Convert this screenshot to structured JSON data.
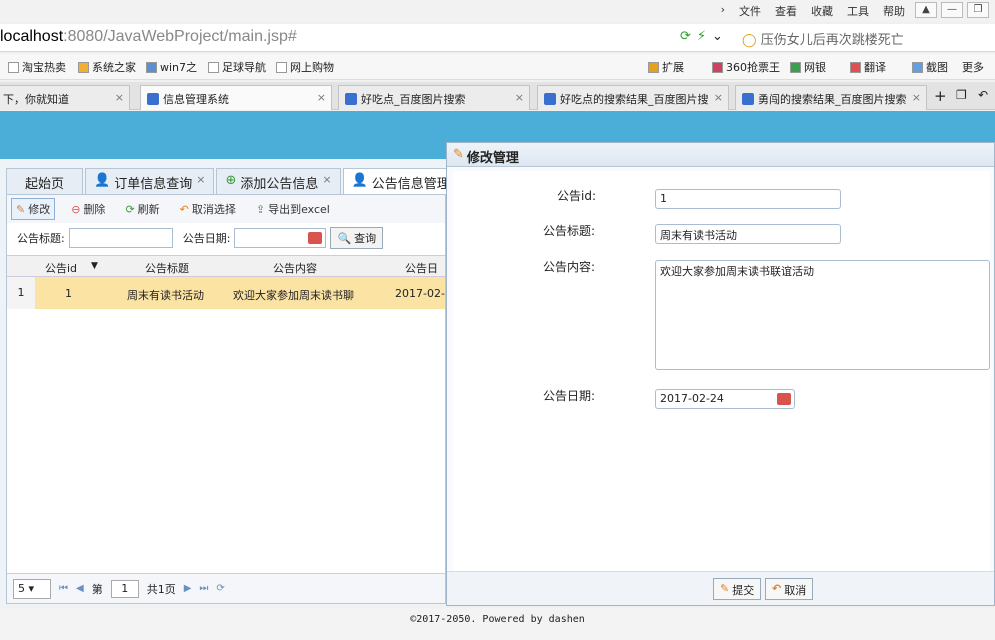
{
  "browser": {
    "menu": [
      "文件",
      "查看",
      "收藏",
      "工具",
      "帮助"
    ],
    "window_buttons": [
      "▲",
      "—",
      "❐"
    ],
    "url_host": "localhost",
    "url_path": ":8080/JavaWebProject/main.jsp#",
    "search_text": "压伤女儿后再次跳楼死亡",
    "bookmarks": [
      "淘宝热卖",
      "系统之家",
      "win7之",
      "足球导航",
      "网上购物"
    ],
    "right_tools": [
      "扩展",
      "360抢票王",
      "网银",
      "翻译",
      "截图",
      "更多"
    ],
    "tabs": [
      {
        "label": "下，你就知道",
        "active": false
      },
      {
        "label": "信息管理系统",
        "active": true
      },
      {
        "label": "好吃点_百度图片搜索",
        "active": false
      },
      {
        "label": "好吃点的搜索结果_百度图片搜",
        "active": false
      },
      {
        "label": "勇闯的搜索结果_百度图片搜索",
        "active": false
      }
    ]
  },
  "app": {
    "tabs": [
      {
        "label": "起始页",
        "closable": false
      },
      {
        "label": "订单信息查询",
        "closable": true
      },
      {
        "label": "添加公告信息",
        "closable": true
      },
      {
        "label": "公告信息管理",
        "closable": false
      }
    ],
    "toolbar": {
      "edit": "修改",
      "delete": "删除",
      "refresh": "刷新",
      "cancel_select": "取消选择",
      "export": "导出到excel"
    },
    "search": {
      "title_label": "公告标题:",
      "date_label": "公告日期:",
      "query_button": "查询"
    },
    "grid": {
      "headers": [
        "公告id",
        "公告标题",
        "公告内容",
        "公告日"
      ],
      "rows": [
        {
          "num": "1",
          "id": "1",
          "title": "周末有读书活动",
          "content": "欢迎大家参加周末读书聊",
          "date": "2017-02-"
        }
      ]
    },
    "pager": {
      "page_size": "5",
      "page_label": "第",
      "page_value": "1",
      "total": "共1页"
    },
    "footer": "©2017-2050. Powered by dashen"
  },
  "dialog": {
    "title": "修改管理",
    "fields": {
      "id_label": "公告id:",
      "id_value": "1",
      "title_label": "公告标题:",
      "title_value": "周末有读书活动",
      "content_label": "公告内容:",
      "content_value": "欢迎大家参加周末读书联谊活动",
      "date_label": "公告日期:",
      "date_value": "2017-02-24"
    },
    "submit": "提交",
    "cancel": "取消"
  },
  "colors": {
    "header_blue": "#4aaed9",
    "selected_row": "#fbe3a4"
  }
}
